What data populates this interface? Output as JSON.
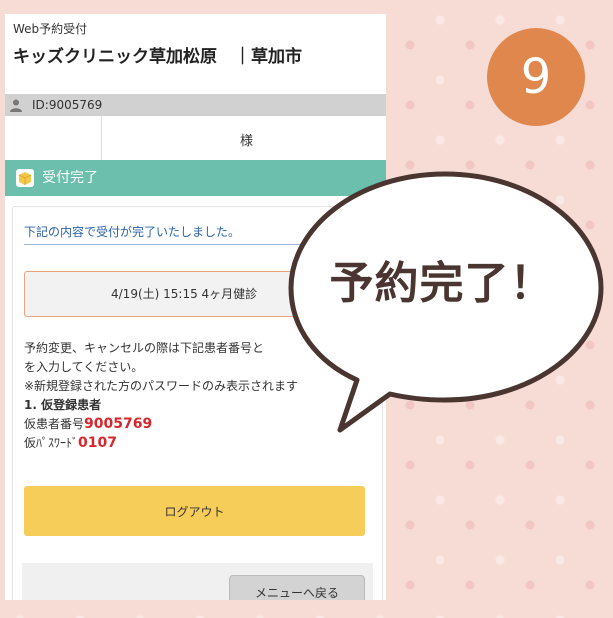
{
  "app_label": "Web予約受付",
  "clinic": {
    "name": "キッズクリニック草加松原　｜草加市"
  },
  "user": {
    "id": "ID:9005769",
    "honorific": "様"
  },
  "header": {
    "title": "受付完了"
  },
  "card": {
    "complete_message": "下記の内容で受付が完了いたしました。",
    "appointment": "4/19(土) 15:15 4ヶ月健診",
    "info_line1": "予約変更、キャンセルの際は下記患者番号と",
    "info_line2": "を入力してください。",
    "info_line3": "※新規登録された方のパスワードのみ表示されます",
    "section_title": "1. 仮登録患者",
    "patient_label": "仮患者番号",
    "patient_number": "9005769",
    "password_label": "仮ﾊﾟｽﾜｰﾄﾞ",
    "password_value": "0107",
    "logout_label": "ログアウト",
    "menu_label": "メニューへ戻る"
  },
  "step_number": "9",
  "bubble_text": "予約完了！",
  "colors": {
    "header_teal": "#6cbfad",
    "logout_yellow": "#f6cd58",
    "badge_orange": "#e0874e",
    "value_red": "#d8262d",
    "message_blue": "#2d63a7"
  }
}
